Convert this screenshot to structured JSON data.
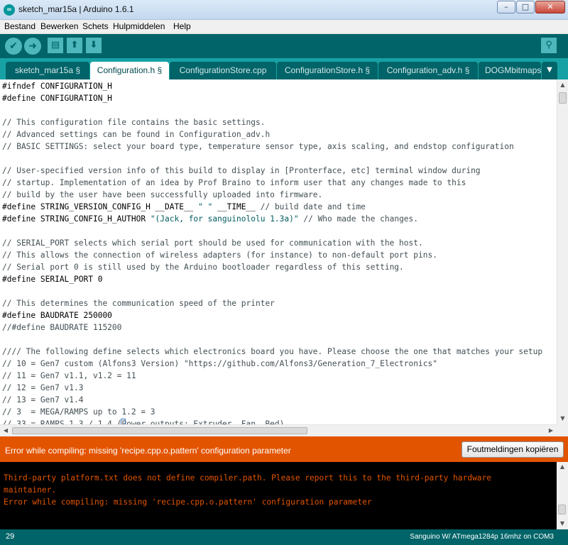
{
  "window": {
    "title": "sketch_mar15a | Arduino 1.6.1",
    "logo_text": "∞",
    "min_symbol": "–",
    "max_symbol": "□",
    "close_symbol": "✕"
  },
  "menu": [
    "Bestand",
    "Bewerken",
    "Schets",
    "Hulpmiddelen",
    "Help"
  ],
  "toolbar": {
    "verify_icon": "check-icon",
    "upload_icon": "arrow-right-icon",
    "new_icon": "new-file-icon",
    "open_icon": "open-icon",
    "save_icon": "save-icon",
    "serial_monitor_icon": "magnifier-icon",
    "accent_color": "#4db7bb",
    "background_color": "#006468"
  },
  "tabs": [
    {
      "label": "sketch_mar15a §",
      "active": false
    },
    {
      "label": "Configuration.h §",
      "active": true
    },
    {
      "label": "ConfigurationStore.cpp",
      "active": false
    },
    {
      "label": "ConfigurationStore.h §",
      "active": false
    },
    {
      "label": "Configuration_adv.h §",
      "active": false
    },
    {
      "label": "DOGMbitmaps.h",
      "active": false
    }
  ],
  "tab_menu_icon": "▼",
  "code_lines": [
    [
      {
        "t": "#ifndef CONFIGURATION_H",
        "c": "kw"
      }
    ],
    [
      {
        "t": "#define CONFIGURATION_H",
        "c": "kw"
      }
    ],
    [
      {
        "t": "",
        "c": "kw"
      }
    ],
    [
      {
        "t": "// This configuration file contains the basic settings.",
        "c": "comment"
      }
    ],
    [
      {
        "t": "// Advanced settings can be found in Configuration_adv.h",
        "c": "comment"
      }
    ],
    [
      {
        "t": "// BASIC SETTINGS: select your board type, temperature sensor type, axis scaling, and endstop configuration",
        "c": "comment"
      }
    ],
    [
      {
        "t": "",
        "c": "kw"
      }
    ],
    [
      {
        "t": "// User-specified version info of this build to display in [Pronterface, etc] terminal window during",
        "c": "comment"
      }
    ],
    [
      {
        "t": "// startup. Implementation of an idea by Prof Braino to inform user that any changes made to this",
        "c": "comment"
      }
    ],
    [
      {
        "t": "// build by the user have been successfully uploaded into firmware.",
        "c": "comment"
      }
    ],
    [
      {
        "t": "#define STRING_VERSION_CONFIG_H __DATE__ ",
        "c": "kw"
      },
      {
        "t": "\" \"",
        "c": "str"
      },
      {
        "t": " __TIME__ ",
        "c": "kw"
      },
      {
        "t": "// build date and time",
        "c": "comment"
      }
    ],
    [
      {
        "t": "#define STRING_CONFIG_H_AUTHOR ",
        "c": "kw"
      },
      {
        "t": "\"(Jack, for sanguinololu 1.3a)\"",
        "c": "str"
      },
      {
        "t": " // Who made the changes.",
        "c": "comment"
      }
    ],
    [
      {
        "t": "",
        "c": "kw"
      }
    ],
    [
      {
        "t": "// SERIAL_PORT selects which serial port should be used for communication with the host.",
        "c": "comment"
      }
    ],
    [
      {
        "t": "// This allows the connection of wireless adapters (for instance) to non-default port pins.",
        "c": "comment"
      }
    ],
    [
      {
        "t": "// Serial port 0 is still used by the Arduino bootloader regardless of this setting.",
        "c": "comment"
      }
    ],
    [
      {
        "t": "#define SERIAL_PORT 0",
        "c": "kw"
      }
    ],
    [
      {
        "t": "",
        "c": "kw"
      }
    ],
    [
      {
        "t": "// This determines the communication speed of the printer",
        "c": "comment"
      }
    ],
    [
      {
        "t": "#define BAUDRATE 250000",
        "c": "kw"
      }
    ],
    [
      {
        "t": "//#define BAUDRATE 115200",
        "c": "comment"
      }
    ],
    [
      {
        "t": "",
        "c": "kw"
      }
    ],
    [
      {
        "t": "//// The following define selects which electronics board you have. Please choose the one that matches your setup",
        "c": "comment"
      }
    ],
    [
      {
        "t": "// 10 = Gen7 custom (Alfons3 Version) \"https://github.com/Alfons3/Generation_7_Electronics\"",
        "c": "comment"
      }
    ],
    [
      {
        "t": "// 11 = Gen7 v1.1, v1.2 = 11",
        "c": "comment"
      }
    ],
    [
      {
        "t": "// 12 = Gen7 v1.3",
        "c": "comment"
      }
    ],
    [
      {
        "t": "// 13 = Gen7 v1.4",
        "c": "comment"
      }
    ],
    [
      {
        "t": "// 3  = MEGA/RAMPS up to 1.2 = 3",
        "c": "comment"
      }
    ],
    [
      {
        "t": "// 33 = RAMPS 1.3 / 1.4 (Power outputs: Extruder, Fan, Bed)",
        "c": "comment"
      }
    ]
  ],
  "status": {
    "message": "Error while compiling: missing 'recipe.cpp.o.pattern' configuration parameter",
    "copy_button": "Foutmeldingen kopiëren",
    "color": "#e35400"
  },
  "console_lines": [
    "Third-party platform.txt does not define compiler.path. Please report this to the third-party hardware",
    "maintainer.",
    "Error while compiling: missing 'recipe.cpp.o.pattern' configuration parameter"
  ],
  "footer": {
    "line_number": "29",
    "board": "Sanguino W/ ATmega1284p 16mhz on COM3"
  },
  "scroll_arrows": {
    "up": "▲",
    "down": "▼",
    "left": "◀",
    "right": "▶"
  }
}
